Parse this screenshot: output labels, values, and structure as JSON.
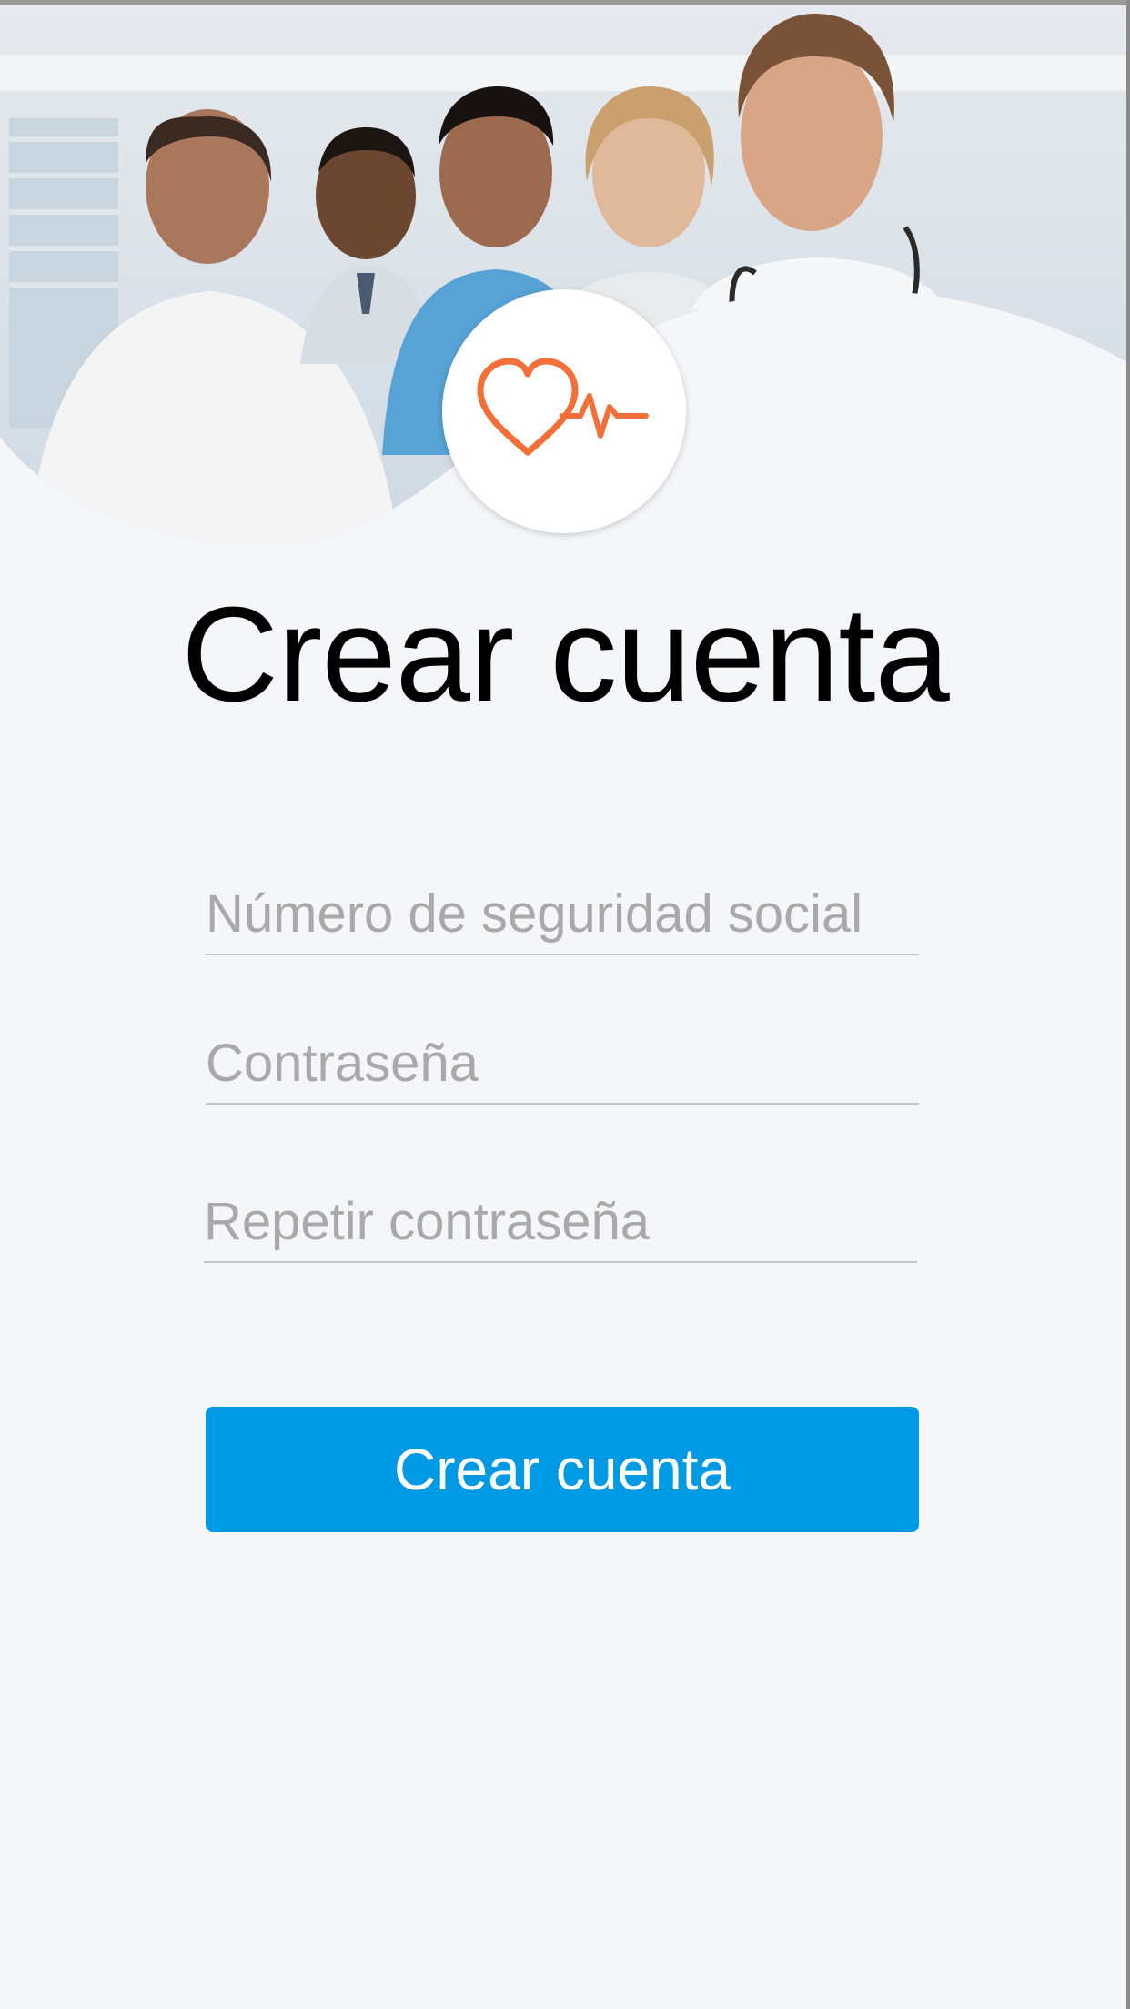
{
  "hero": {
    "image_description_icon": "medical-team-photo"
  },
  "logo": {
    "icon": "heartbeat-icon",
    "color": "#f36f3a"
  },
  "title": "Crear cuenta",
  "form": {
    "ssn_placeholder": "Número de seguridad social",
    "password_placeholder": "Contraseña",
    "repeat_password_placeholder": "Repetir contraseña",
    "submit_label": "Crear cuenta"
  },
  "colors": {
    "background": "#f4f6fa",
    "button": "#009ae4",
    "button_text": "#ffffff",
    "placeholder": "#a9a9a9",
    "underline": "#c4c4c4"
  }
}
